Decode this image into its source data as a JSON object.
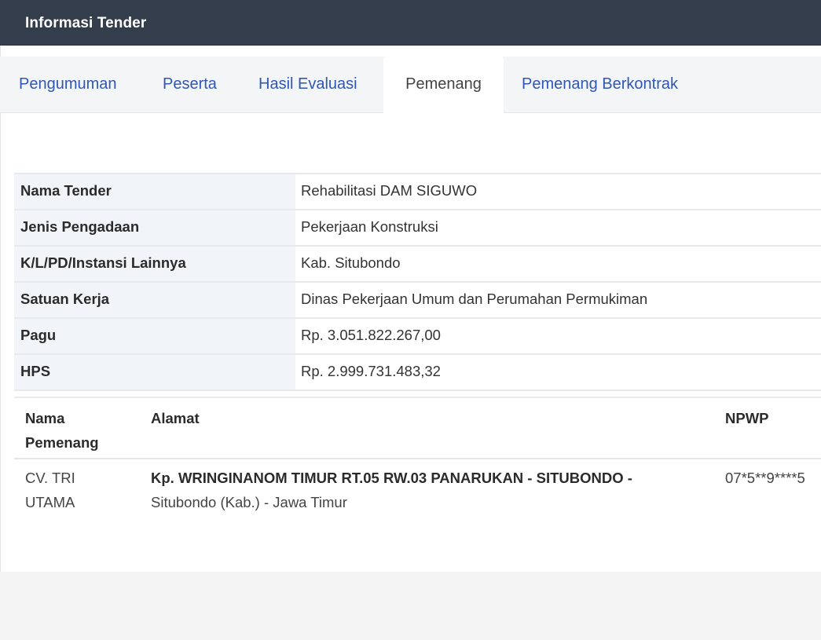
{
  "header": {
    "title": "Informasi Tender"
  },
  "tabs": [
    {
      "label": "Pengumuman",
      "active": false
    },
    {
      "label": "Peserta",
      "active": false
    },
    {
      "label": "Hasil Evaluasi",
      "active": false
    },
    {
      "label": "Pemenang",
      "active": true
    },
    {
      "label": "Pemenang Berkontrak",
      "active": false
    }
  ],
  "info": [
    {
      "label": "Nama Tender",
      "value": "Rehabilitasi DAM SIGUWO"
    },
    {
      "label": "Jenis Pengadaan",
      "value": "Pekerjaan Konstruksi"
    },
    {
      "label": "K/L/PD/Instansi Lainnya",
      "value": "Kab. Situbondo"
    },
    {
      "label": "Satuan Kerja",
      "value": "Dinas Pekerjaan Umum dan Perumahan Permukiman"
    },
    {
      "label": "Pagu",
      "value": "Rp. 3.051.822.267,00"
    },
    {
      "label": "HPS",
      "value": "Rp. 2.999.731.483,32"
    }
  ],
  "winner_table": {
    "headers": {
      "name_line1": "Nama",
      "name_line2": "Pemenang",
      "address": "Alamat",
      "npwp": "NPWP"
    },
    "rows": [
      {
        "name_line1": "CV. TRI",
        "name_line2": "UTAMA",
        "address_bold": "Kp. WRINGINANOM TIMUR RT.05 RW.03 PANARUKAN - SITUBONDO -",
        "address_rest": "Situbondo (Kab.) - Jawa Timur",
        "npwp": "07*5**9****5"
      }
    ]
  },
  "colors": {
    "header_bg": "#343d4b",
    "tab_link": "#2f57b5",
    "label_bg": "#f1f4f9"
  }
}
